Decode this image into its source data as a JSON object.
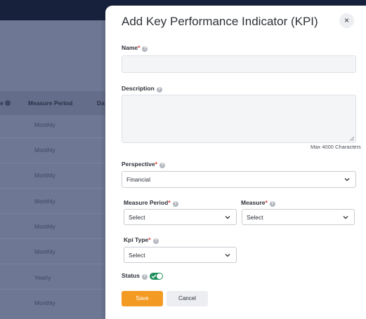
{
  "background": {
    "columns": {
      "partial": "e",
      "measure_period": "Measure Period",
      "day": "Da"
    },
    "rows": [
      "Monthly",
      "Monthly",
      "Monthly",
      "Monthly",
      "Monthly",
      "Monthly",
      "Yearly",
      "Monthly"
    ]
  },
  "modal": {
    "title": "Add Key Performance Indicator (KPI)",
    "close_glyph": "×",
    "name": {
      "label": "Name",
      "required": "*",
      "value": ""
    },
    "description": {
      "label": "Description",
      "value": "",
      "hint": "Max 4000 Characters"
    },
    "perspective": {
      "label": "Perspective",
      "required": "*",
      "value": "Financial"
    },
    "measure_period": {
      "label": "Measure Period",
      "required": "*",
      "value": "Select"
    },
    "measure": {
      "label": "Measure",
      "required": "*",
      "value": "Select"
    },
    "kpi_type": {
      "label": "Kpi Type",
      "required": "*",
      "value": "Select"
    },
    "status": {
      "label": "Status",
      "enabled": true
    },
    "buttons": {
      "save": "Save",
      "cancel": "Cancel"
    }
  },
  "icons": {
    "help": "question-circle-icon",
    "close": "close-icon",
    "chevron": "chevron-down-icon",
    "check": "check-icon"
  },
  "colors": {
    "overlay": "#6e7793",
    "topbar": "#17213c",
    "accent": "#f39a22",
    "toggle_on": "#1e8f5c",
    "required": "#e0312b"
  }
}
